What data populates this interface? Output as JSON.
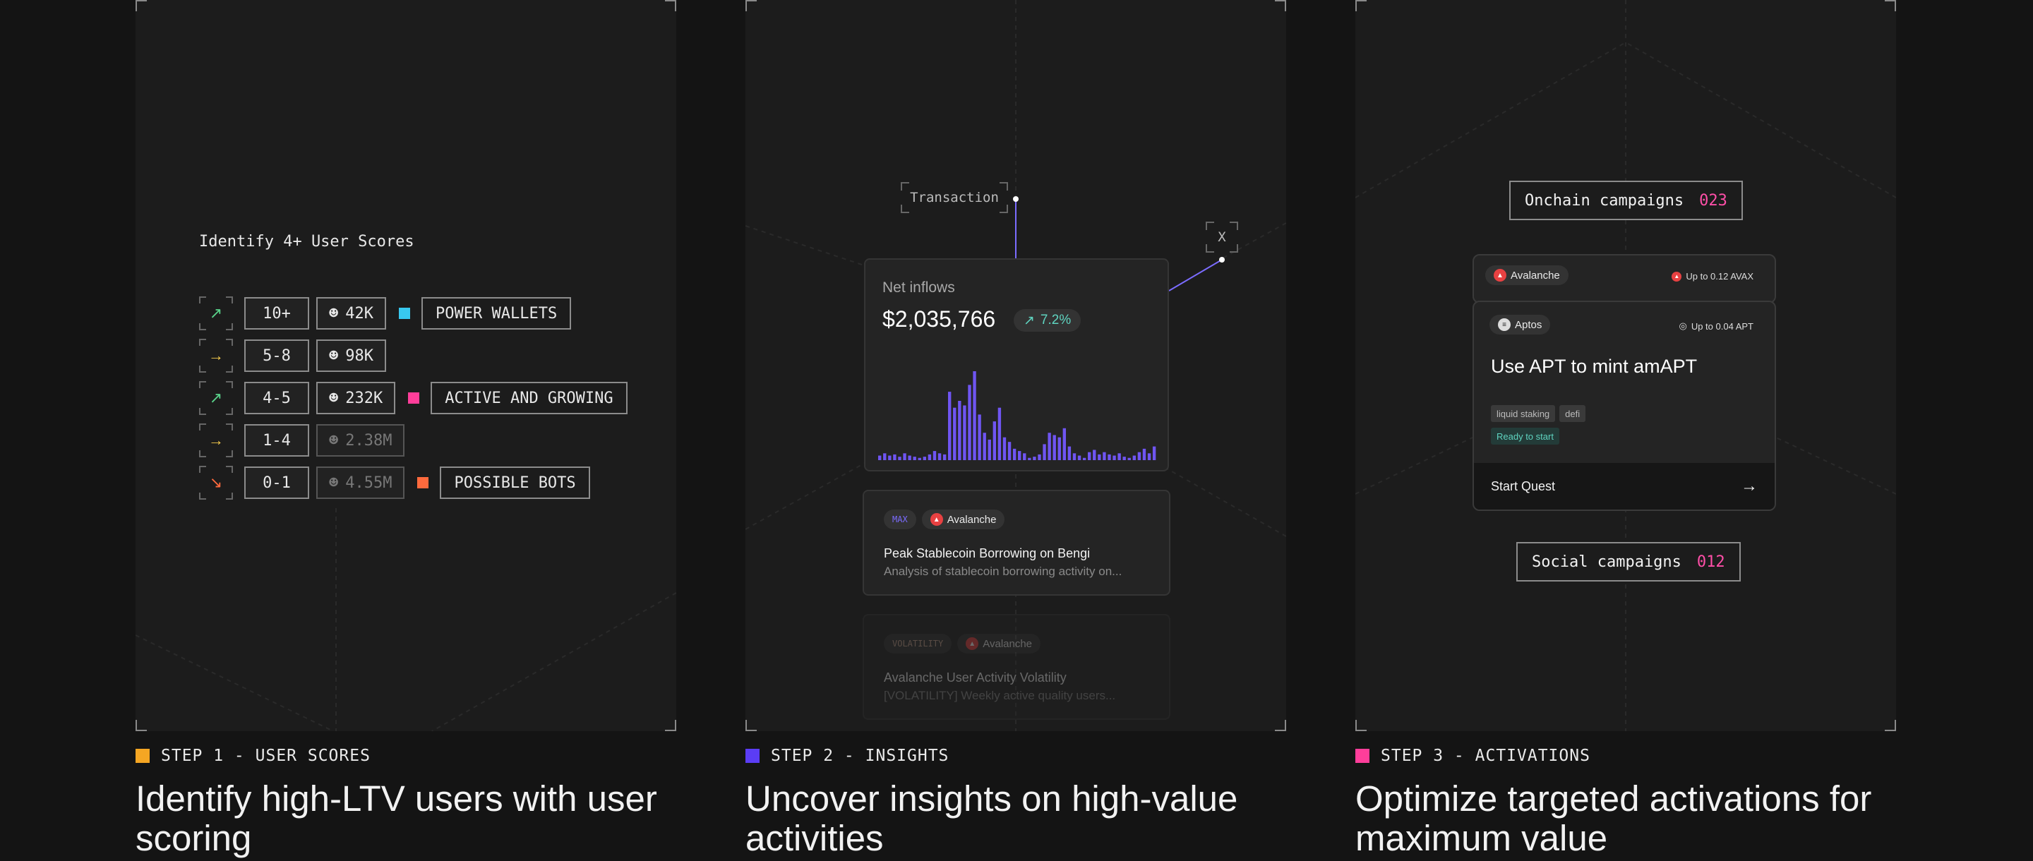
{
  "panel1": {
    "title": "Identify 4+ User Scores",
    "rows": [
      {
        "arrow": "↗",
        "arrow_color": "#59d38a",
        "range": "10+",
        "users": "42K",
        "dim": false,
        "label": "POWER WALLETS",
        "label_color": "#38c8ef"
      },
      {
        "arrow": "→",
        "arrow_color": "#f2c94c",
        "range": "5-8",
        "users": "98K",
        "dim": false,
        "label": "",
        "label_color": ""
      },
      {
        "arrow": "↗",
        "arrow_color": "#59d38a",
        "range": "4-5",
        "users": "232K",
        "dim": false,
        "label": "ACTIVE AND GROWING",
        "label_color": "#ff3e9a"
      },
      {
        "arrow": "→",
        "arrow_color": "#f2c94c",
        "range": "1-4",
        "users": "2.38M",
        "dim": true,
        "label": "",
        "label_color": ""
      },
      {
        "arrow": "↘",
        "arrow_color": "#ff6a3d",
        "range": "0-1",
        "users": "4.55M",
        "dim": true,
        "label": "POSSIBLE BOTS",
        "label_color": "#ff6a3d"
      }
    ]
  },
  "panel2": {
    "transaction_tag": "Transaction",
    "x_tag": "X",
    "net_inflows": {
      "label": "Net inflows",
      "value": "$2,035,766",
      "change": "7.2%",
      "change_icon": "arrow-up-right-icon"
    },
    "chart_data": {
      "type": "bar",
      "color": "#6f55f2",
      "values": [
        4,
        6,
        4,
        5,
        3,
        6,
        4,
        3,
        2,
        3,
        5,
        8,
        6,
        5,
        60,
        46,
        52,
        48,
        66,
        78,
        40,
        24,
        18,
        34,
        46,
        20,
        16,
        10,
        8,
        6,
        2,
        3,
        5,
        14,
        24,
        22,
        20,
        28,
        12,
        6,
        4,
        2,
        7,
        9,
        5,
        7,
        5,
        4,
        6,
        3,
        2,
        4,
        7,
        10,
        6,
        12
      ]
    },
    "insights": [
      {
        "tag": "MAX",
        "chain": "Avalanche",
        "title": "Peak Stablecoin Borrowing on Bengi",
        "desc": "Analysis of stablecoin borrowing activity on..."
      },
      {
        "tag": "VOLATILITY",
        "chain": "Avalanche",
        "title": "Avalanche User Activity Volatility",
        "desc": "[VOLATILITY] Weekly active quality users..."
      }
    ]
  },
  "panel3": {
    "onchain": {
      "label": "Onchain campaigns",
      "count": "023"
    },
    "social": {
      "label": "Social campaigns",
      "count": "012"
    },
    "back_card": {
      "chain": "Avalanche",
      "reward": "Up to 0.12 AVAX"
    },
    "front_card": {
      "chain": "Aptos",
      "reward": "Up to 0.04 APT",
      "title": "Use APT to mint amAPT",
      "tags": [
        "liquid staking",
        "defi"
      ],
      "status": "Ready to start",
      "cta": "Start Quest"
    }
  },
  "steps": [
    {
      "label": "STEP 1 - USER SCORES",
      "color": "#f5a623",
      "heading": "Identify high-LTV users with user scoring"
    },
    {
      "label": "STEP 2 - INSIGHTS",
      "color": "#5b3df5",
      "heading": "Uncover insights on high-value activities"
    },
    {
      "label": "STEP 3 - ACTIVATIONS",
      "color": "#ff3e9a",
      "heading": "Optimize targeted activations for maximum value"
    }
  ]
}
